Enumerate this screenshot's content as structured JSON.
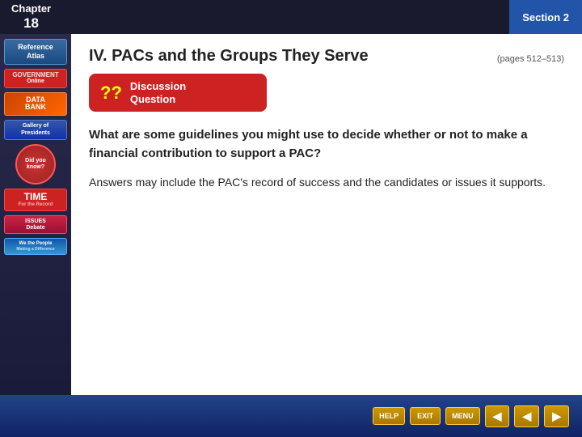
{
  "header": {
    "chapter_label": "Chapter",
    "chapter_number": "18",
    "section_label": "Section 2"
  },
  "sidebar": {
    "items": [
      {
        "id": "reference-atlas",
        "line1": "Reference",
        "line2": "Atlas"
      },
      {
        "id": "government-online",
        "line1": "GOVERNMENT",
        "line2": "Online"
      },
      {
        "id": "data-bank",
        "line1": "DATA",
        "line2": "BANK"
      },
      {
        "id": "gallery-presidents",
        "line1": "Gallery of",
        "line2": "Presidents"
      },
      {
        "id": "did-you-know",
        "line1": "Did you",
        "line2": "know?"
      },
      {
        "id": "time-record",
        "line1": "TIME",
        "line2": "For the Record"
      },
      {
        "id": "issues-debate",
        "line1": "ISSUES",
        "line2": "Debate"
      },
      {
        "id": "we-the-people",
        "line1": "We the People",
        "line2": "Making a Difference"
      }
    ]
  },
  "content": {
    "title": "IV. PACs and the Groups They Serve",
    "pages": "(pages 512–513)",
    "discussion_label_line1": "Discussion",
    "discussion_label_line2": "Question",
    "question": "What are some guidelines you might use to decide whether or not to make a financial contribution to support a PAC?",
    "answer": "Answers may include the PAC's record of success and the candidates or issues it supports."
  },
  "bottom_nav": {
    "help": "HELP",
    "exit": "EXIT",
    "menu": "MENU",
    "prev_arrow": "◀",
    "back_arrow": "◀",
    "next_arrow": "▶"
  }
}
